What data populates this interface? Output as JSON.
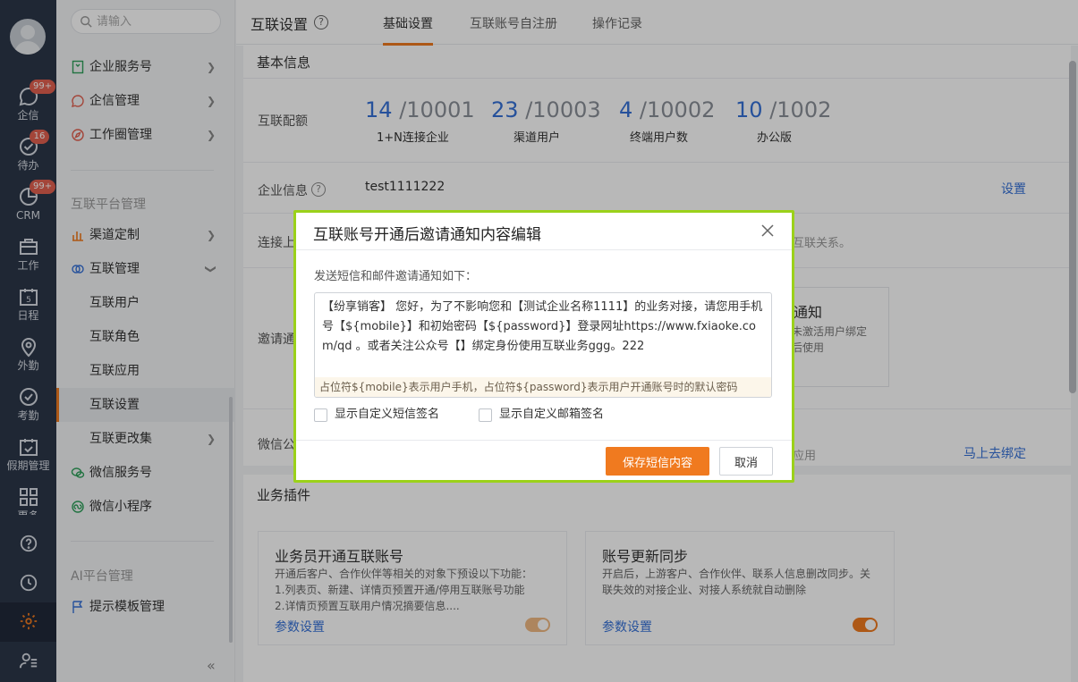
{
  "rail": {
    "items": [
      {
        "label": "企信",
        "badge": "99+"
      },
      {
        "label": "待办",
        "badge": "16"
      },
      {
        "label": "CRM",
        "badge": "99+"
      },
      {
        "label": "工作"
      },
      {
        "label": "日程",
        "day": "5"
      },
      {
        "label": "外勤"
      },
      {
        "label": "考勤"
      },
      {
        "label": "假期管理"
      },
      {
        "label": "更多"
      }
    ]
  },
  "sidebar": {
    "search_placeholder": "请输入",
    "items_top": [
      "企业服务号",
      "企信管理",
      "工作圈管理"
    ],
    "group1_title": "互联平台管理",
    "items_platform": [
      "渠道定制",
      "互联管理",
      "互联用户",
      "互联角色",
      "互联应用",
      "互联设置",
      "互联更改集",
      "微信服务号",
      "微信小程序"
    ],
    "group2_title": "AI平台管理",
    "items_ai": [
      "提示模板管理"
    ]
  },
  "header": {
    "title": "互联设置",
    "tabs": [
      "基础设置",
      "互联账号自注册",
      "操作记录"
    ]
  },
  "basic": {
    "title": "基本信息",
    "quota_label": "互联配额",
    "quotas": [
      {
        "used": "14",
        "total": "/10001",
        "caption": "1+N连接企业"
      },
      {
        "used": "23",
        "total": "/10003",
        "caption": "渠道用户"
      },
      {
        "used": "4",
        "total": "/10002",
        "caption": "终端用户数"
      },
      {
        "used": "10",
        "total": "/1002",
        "caption": "办公版"
      }
    ],
    "enterprise_label": "企业信息",
    "enterprise_value": "test1111222",
    "enterprise_link": "设置",
    "connect_label": "连接上",
    "connect_tail": "互联关系。",
    "invite_label": "邀请通",
    "notify_title": "通知",
    "notify_desc_1": "未激活用户绑定",
    "notify_desc_2": "后使用",
    "wechat_label": "微信公",
    "wechat_tail": "应用",
    "wechat_link": "马上去绑定"
  },
  "plugins": {
    "title": "业务插件",
    "cards": [
      {
        "title": "业务员开通互联账号",
        "desc": [
          "开通后客户、合作伙伴等相关的对象下预设以下功能：",
          "1.列表页、新建、详情页预置开通/停用互联账号功能",
          "2.详情页预置互联用户情况摘要信息...."
        ],
        "link": "参数设置"
      },
      {
        "title": "账号更新同步",
        "desc": [
          "开启后，上游客户、合作伙伴、联系人信息删改同步。关",
          "联失效的对接企业、对接人系统就自动删除"
        ],
        "link": "参数设置"
      }
    ]
  },
  "modal": {
    "title": "互联账号开通后邀请通知内容编辑",
    "intro": "发送短信和邮件邀请通知如下：",
    "body": "【纷享销客】 您好，为了不影响您和【测试企业名称1111】的业务对接，请您用手机号【${mobile}】和初始密码【${password}】登录网址https://www.fxiaoke.com/qd 。或者关注公众号【】绑定身份使用互联业务ggg。222",
    "tip": "占位符${mobile}表示用户手机，占位符${password}表示用户开通账号时的默认密码",
    "check_sms": "显示自定义短信签名",
    "check_mail": "显示自定义邮箱签名",
    "save": "保存短信内容",
    "cancel": "取消"
  }
}
